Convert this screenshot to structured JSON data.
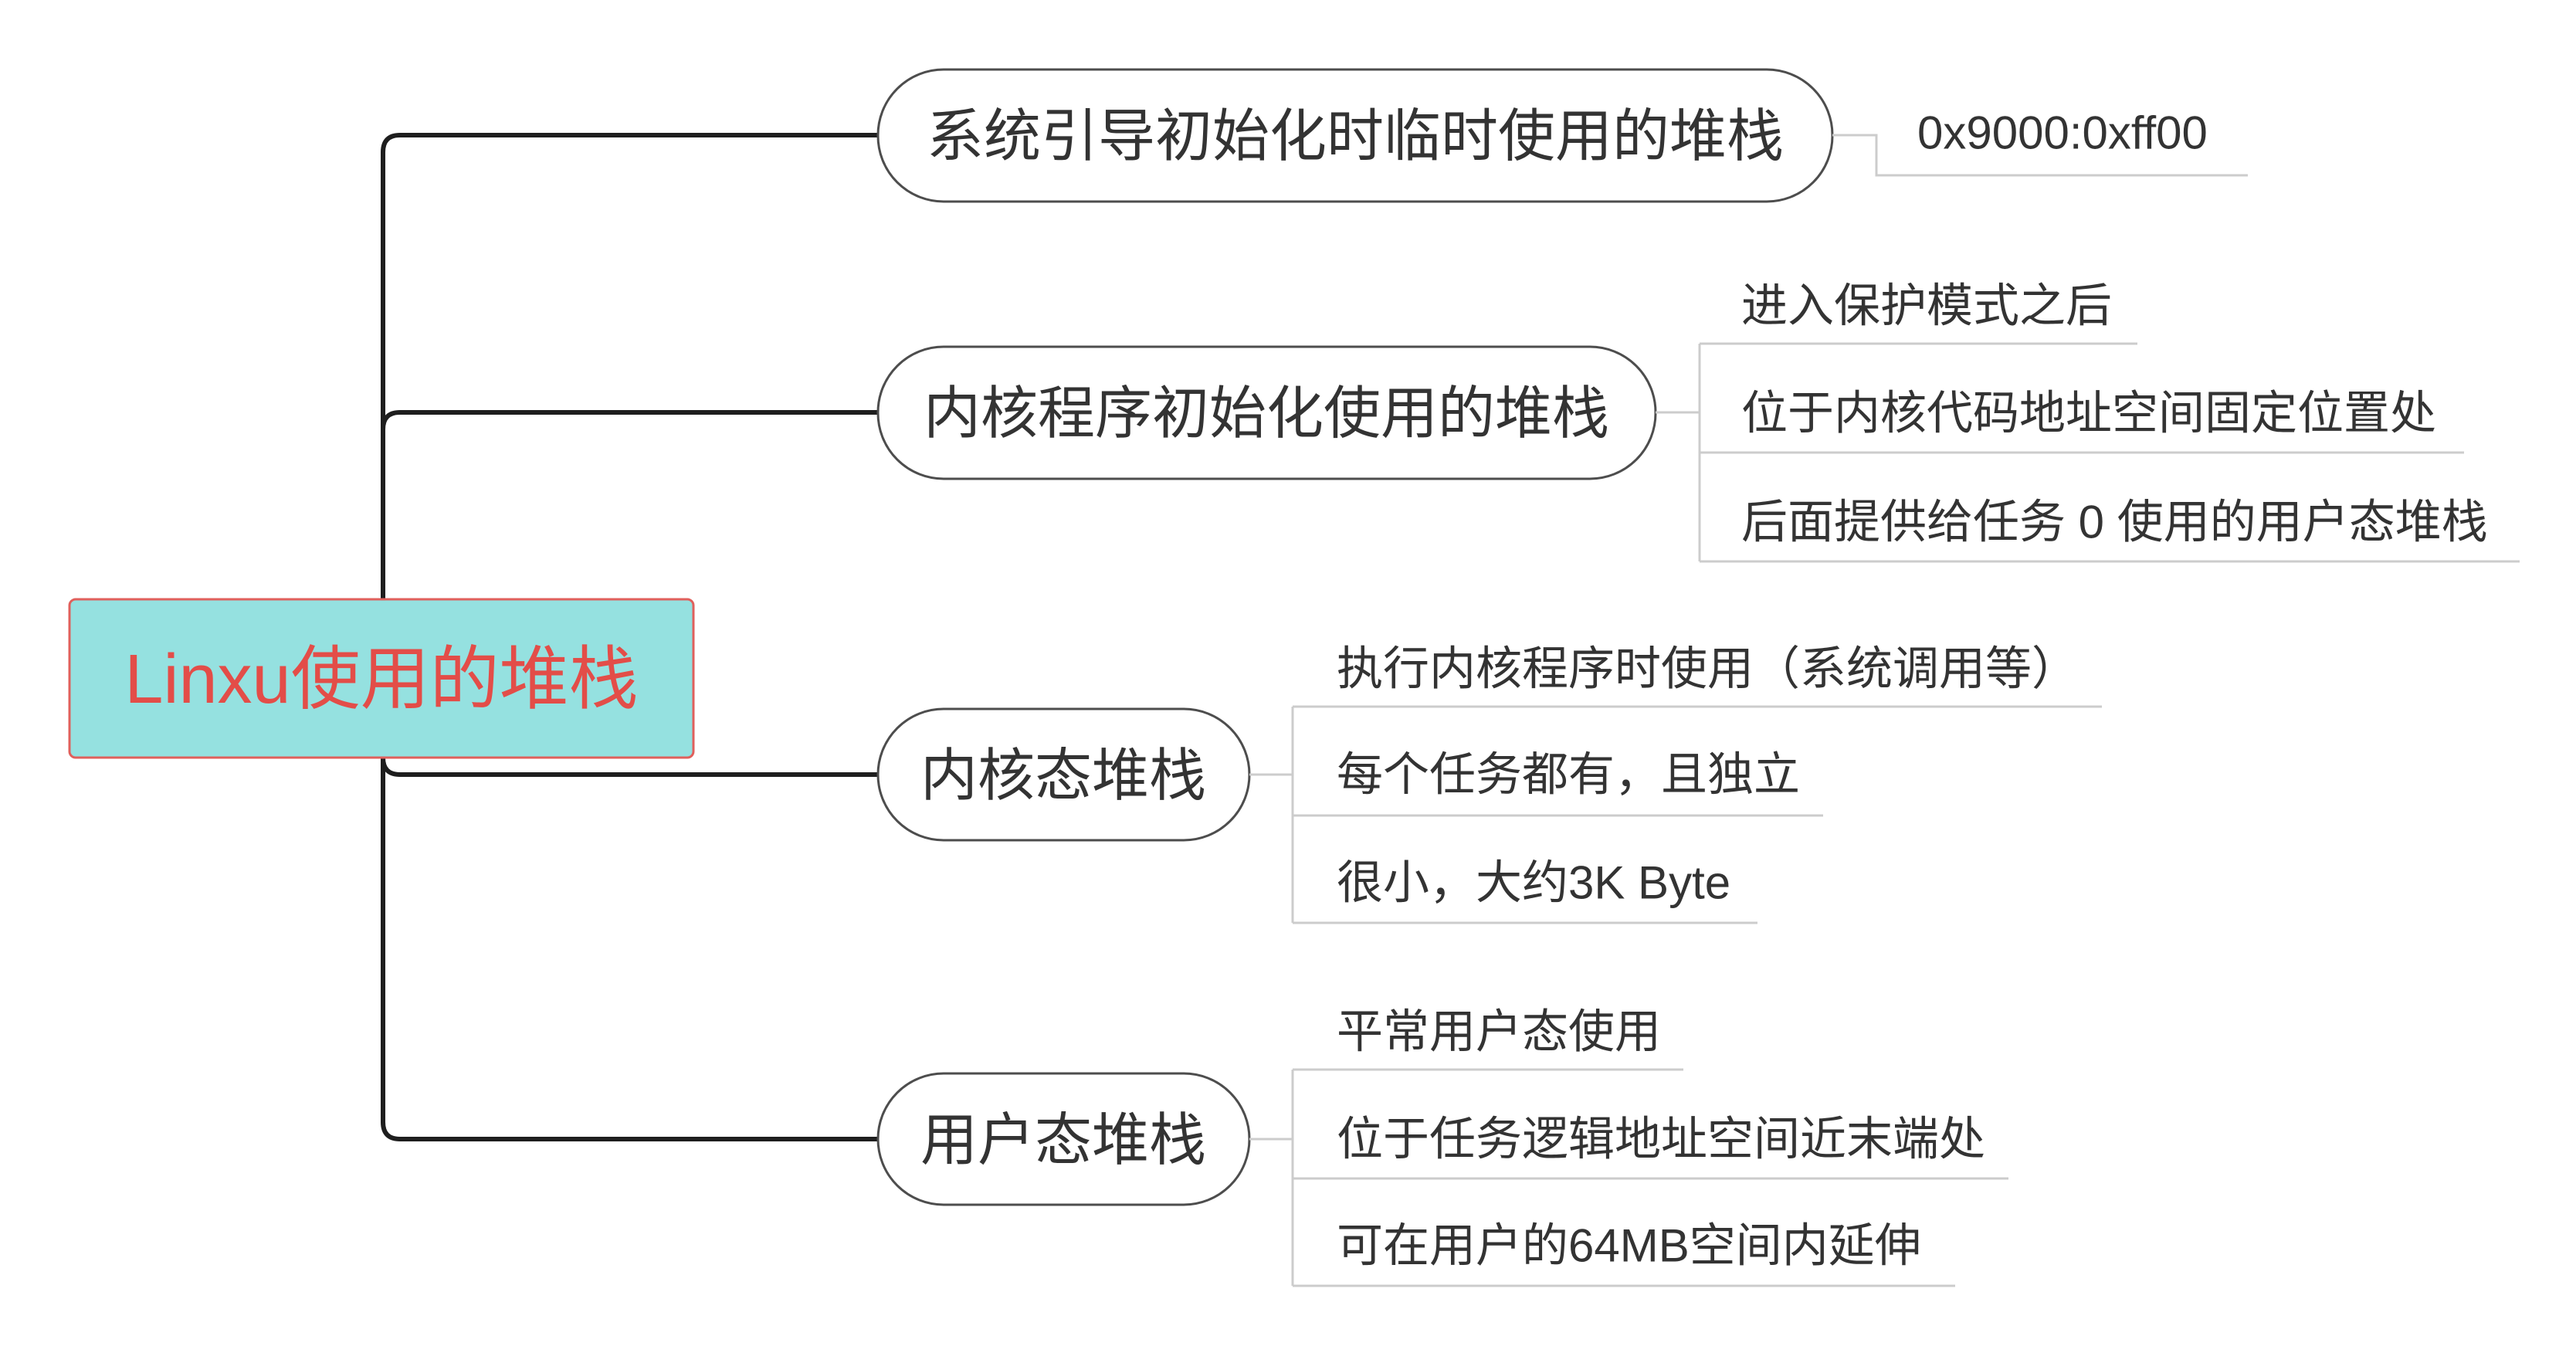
{
  "root": {
    "label": "Linxu使用的堆栈"
  },
  "branches": [
    {
      "label": "系统引导初始化时临时使用的堆栈",
      "leaves": [
        "0x9000:0xff00"
      ]
    },
    {
      "label": "内核程序初始化使用的堆栈",
      "leaves": [
        "进入保护模式之后",
        "位于内核代码地址空间固定位置处",
        "后面提供给任务 0 使用的用户态堆栈"
      ]
    },
    {
      "label": "内核态堆栈",
      "leaves": [
        "执行内核程序时使用（系统调用等）",
        "每个任务都有，且独立",
        "很小，大约3K Byte"
      ]
    },
    {
      "label": "用户态堆栈",
      "leaves": [
        "平常用户态使用",
        "位于任务逻辑地址空间近末端处",
        "可在用户的64MB空间内延伸"
      ]
    }
  ],
  "colors": {
    "root_fill": "#95e1e0",
    "root_border": "#e0605c",
    "root_text": "#e34d48",
    "node_fill": "#ffffff",
    "node_border": "#4d4d4d",
    "trunk_line": "#1e1e1e",
    "leaf_line": "#cccccc",
    "text": "#333333"
  }
}
